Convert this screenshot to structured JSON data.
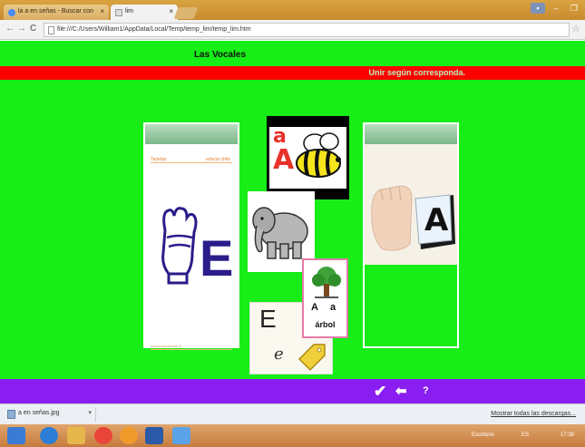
{
  "browser": {
    "tabs": [
      {
        "label": "la a en señas - Buscar con",
        "close": "×"
      },
      {
        "label": "lim",
        "close": "×"
      }
    ],
    "address": "file:///C:/Users/William1/AppData/Local/Temp/temp_lim/temp_lim.htm",
    "back": "←",
    "forward": "→",
    "reload": "C",
    "star": "☆",
    "window_buttons": [
      "–",
      "❐"
    ]
  },
  "activity": {
    "title": "Las Vocales",
    "instruction": "Unir según corresponda.",
    "left_card": {
      "letter": "E",
      "sheet_label": "Tarjetas",
      "brand": "educar chile",
      "footer": "www.educarchile.cl"
    },
    "cards": [
      {
        "name": "bee",
        "letters": [
          "a",
          "A"
        ]
      },
      {
        "name": "elephant"
      },
      {
        "name": "tree",
        "letters": [
          "A",
          "a"
        ],
        "word": "árbol"
      },
      {
        "name": "letter-e",
        "letters": [
          "E",
          "e"
        ]
      }
    ],
    "right_card": {
      "letter": "A"
    },
    "controls": {
      "check": "✔",
      "back": "⬅",
      "help": "?"
    }
  },
  "downloads": {
    "file": "a en señas.jpg",
    "show_all": "Mostrar todas las descargas..."
  },
  "taskbar": {
    "lang": "Escritorio",
    "tray": "ES",
    "time": "17:38"
  },
  "colors": {
    "stage_green": "#17ee17",
    "red_bar": "#ff0000",
    "purple_bar": "#8a1ef0",
    "letter_blue": "#2a1d8a"
  }
}
